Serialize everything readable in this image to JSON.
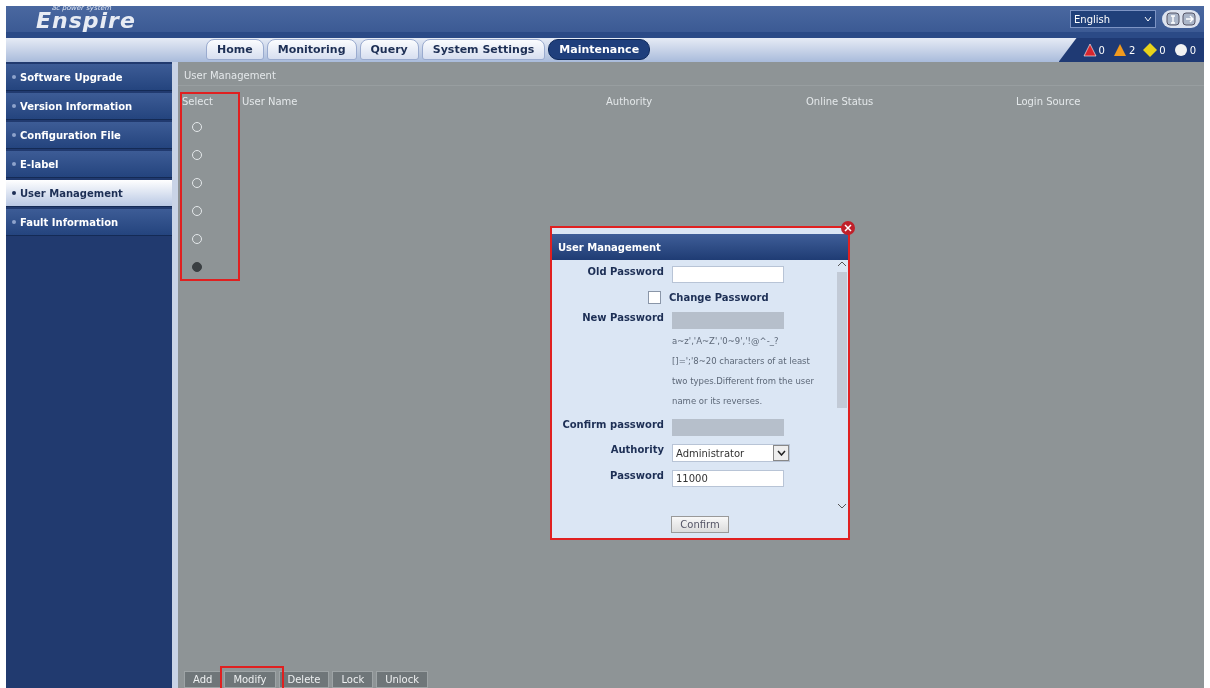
{
  "logo": {
    "brand": "Enspire",
    "tagline": "ac power system"
  },
  "language": {
    "value": "English"
  },
  "tabs": [
    {
      "label": "Home",
      "selected": false
    },
    {
      "label": "Monitoring",
      "selected": false
    },
    {
      "label": "Query",
      "selected": false
    },
    {
      "label": "System Settings",
      "selected": false
    },
    {
      "label": "Maintenance",
      "selected": true
    }
  ],
  "alarms": [
    {
      "kind": "critical",
      "count": "0"
    },
    {
      "kind": "major",
      "count": "2"
    },
    {
      "kind": "minor",
      "count": "0"
    },
    {
      "kind": "warning",
      "count": "0"
    }
  ],
  "sidebar": {
    "items": [
      {
        "label": "Software Upgrade",
        "selected": false
      },
      {
        "label": "Version Information",
        "selected": false
      },
      {
        "label": "Configuration File",
        "selected": false
      },
      {
        "label": "E-label",
        "selected": false
      },
      {
        "label": "User Management",
        "selected": true
      },
      {
        "label": "Fault Information",
        "selected": false
      }
    ]
  },
  "content": {
    "title": "User Management",
    "table": {
      "columns": [
        "Select",
        "User Name",
        "Authority",
        "Online Status",
        "Login Source"
      ],
      "rows": [
        {
          "selected": false
        },
        {
          "selected": false
        },
        {
          "selected": false
        },
        {
          "selected": false
        },
        {
          "selected": false
        },
        {
          "selected": true
        }
      ]
    },
    "buttons": [
      "Add",
      "Modify",
      "Delete",
      "Lock",
      "Unlock"
    ]
  },
  "dialog": {
    "title": "User Management",
    "old_password": {
      "label": "Old Password"
    },
    "change_password": {
      "label": "Change Password",
      "checked": false
    },
    "new_password": {
      "label": "New Password",
      "disabled": true,
      "hint": "a~z','A~Z','0~9','!@^-_?[]=';'8~20 characters of at least two types.Different from the user name or its reverses."
    },
    "confirm_password": {
      "label": "Confirm password",
      "disabled": true
    },
    "authority": {
      "label": "Authority",
      "value": "Administrator"
    },
    "password_validity": {
      "label": "Password",
      "value": "11000"
    },
    "confirm_button": "Confirm"
  }
}
